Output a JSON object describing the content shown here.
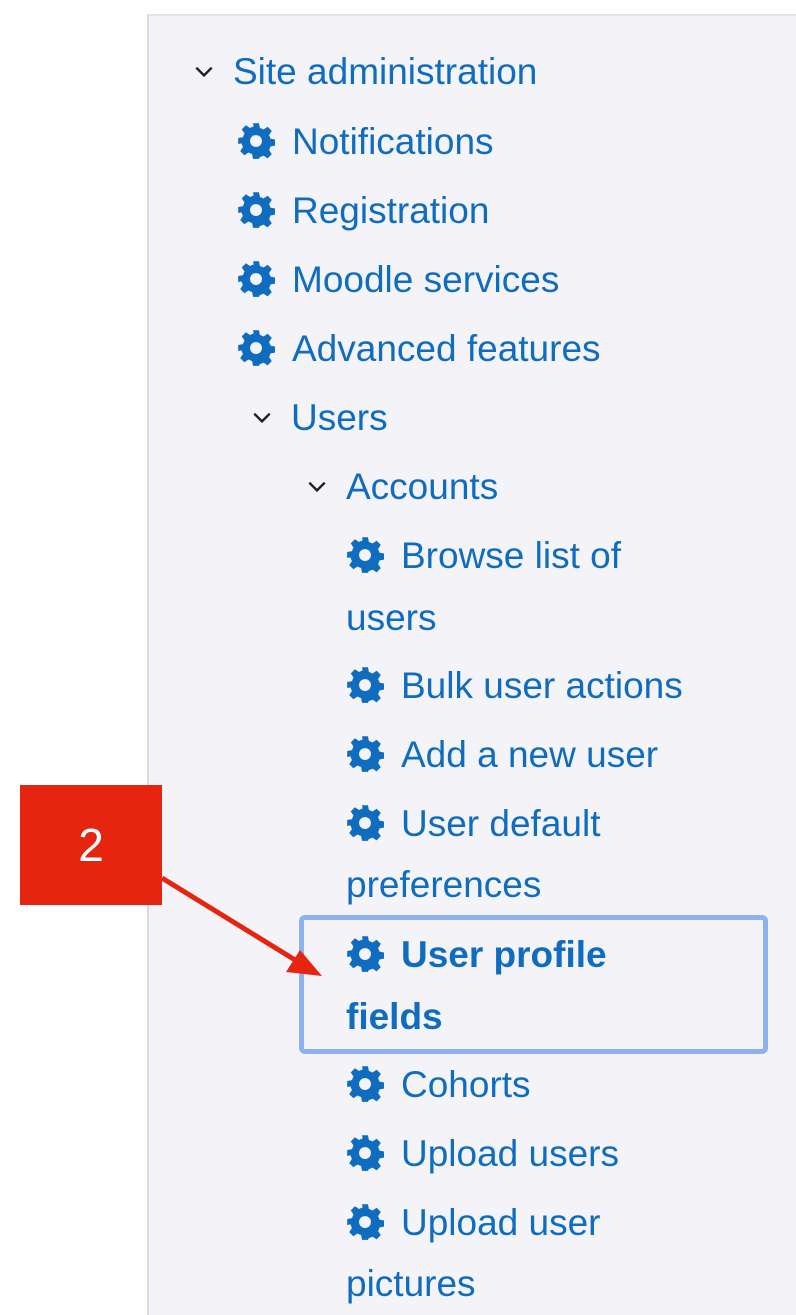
{
  "nav": {
    "site_admin": "Site administration",
    "notifications": "Notifications",
    "registration": "Registration",
    "moodle_services": "Moodle services",
    "advanced_features": "Advanced features",
    "users": "Users",
    "accounts": "Accounts",
    "browse_line1": "Browse list of",
    "browse_line2": "users",
    "bulk_actions": "Bulk user actions",
    "add_user": "Add a new user",
    "default_prefs_line1": "User default",
    "default_prefs_line2": "preferences",
    "profile_fields_line1": "User profile",
    "profile_fields_line2": "fields",
    "cohorts": "Cohorts",
    "upload_users": "Upload users",
    "upload_pictures_line1": "Upload user",
    "upload_pictures_line2": "pictures"
  },
  "annotation": {
    "step_number": "2"
  },
  "colors": {
    "link": "#0f6cbf",
    "panel_bg": "#f4f4f8",
    "callout": "#e5250f",
    "highlight_border": "#8eb2ef"
  }
}
